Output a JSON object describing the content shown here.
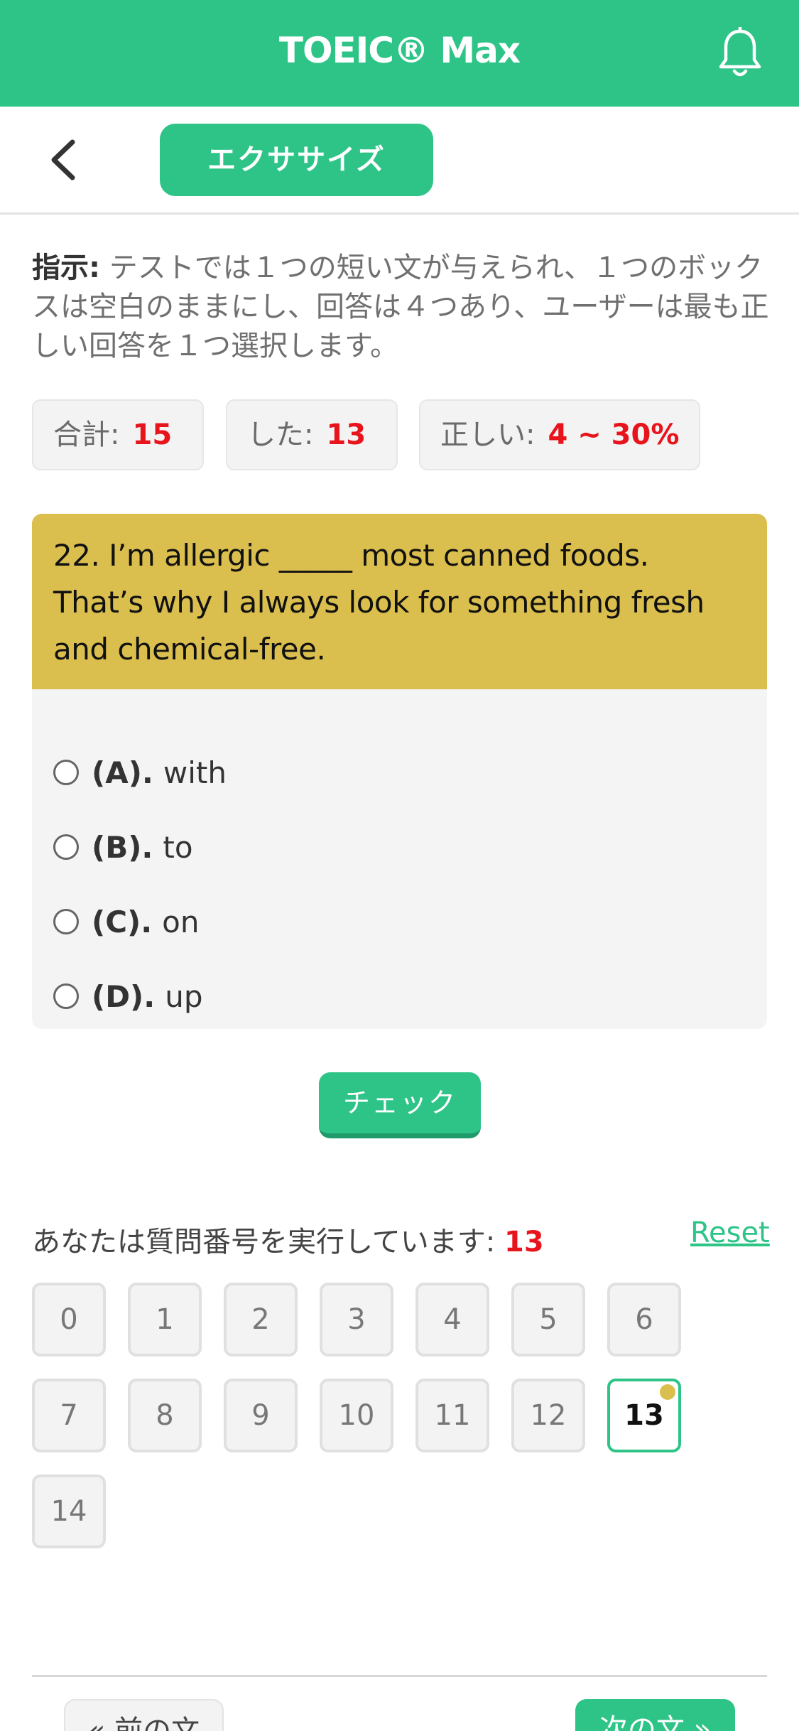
{
  "header": {
    "title": "TOEIC® Max",
    "notification_icon": "bell-icon"
  },
  "nav": {
    "back_icon": "chevron-left-icon",
    "tab_label": "エクササイズ"
  },
  "instruction": {
    "label": "指示:",
    "text": " テストでは１つの短い文が与えられ、１つのボックスは空白のままにし、回答は４つあり、ユーザーは最も正しい回答を１つ選択します。"
  },
  "stats": {
    "total_label": "合計:",
    "total_value": "15",
    "done_label": "した:",
    "done_value": "13",
    "correct_label": "正しい:",
    "correct_value": "4 ~ 30%"
  },
  "question": {
    "text": "22. I’m allergic _____ most canned foods. That’s why I always look for something fresh and chemical-free.",
    "options": [
      {
        "letter": "(A).",
        "text": "with"
      },
      {
        "letter": "(B).",
        "text": "to"
      },
      {
        "letter": "(C).",
        "text": "on"
      },
      {
        "letter": "(D).",
        "text": "up"
      }
    ]
  },
  "check_label": "チェック",
  "progress": {
    "label": "あなたは質問番号を実行しています: ",
    "current": "13",
    "reset_label": "Reset"
  },
  "question_numbers": [
    "0",
    "1",
    "2",
    "3",
    "4",
    "5",
    "6",
    "7",
    "8",
    "9",
    "10",
    "11",
    "12",
    "13",
    "14"
  ],
  "active_question": "13",
  "footer": {
    "prev_label": "« 前の文",
    "next_label": "次の文 »"
  },
  "colors": {
    "primary": "#2ec488",
    "question_bg": "#dbbf4e",
    "highlight": "#e8141c"
  }
}
